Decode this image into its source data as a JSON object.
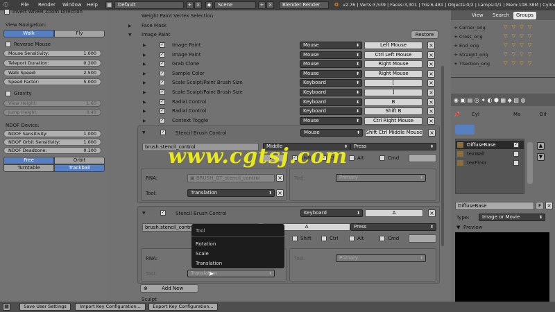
{
  "topbar": {
    "menus": [
      "File",
      "Render",
      "Window",
      "Help"
    ],
    "layout": "Default",
    "scene": "Scene",
    "engine": "Blender Render",
    "stats": "v2.76 | Verts:3,539 | Faces:3,301 | Tris:6,481 | Objects:0/2 | Lamps:0/1 | Mem:108.38M | Cyline"
  },
  "left": {
    "invert_wheel": "Invert Wheel Zoom Direction",
    "nav_title": "View Navigation:",
    "walk": "Walk",
    "fly": "Fly",
    "reverse_mouse": "Reverse Mouse",
    "fields": [
      {
        "label": "Mouse Sensitivity:",
        "value": "1.000"
      },
      {
        "label": "Teleport Duration:",
        "value": "0.200"
      },
      {
        "label": "Walk Speed:",
        "value": "2.500"
      },
      {
        "label": "Speed Factor:",
        "value": "5.000"
      }
    ],
    "gravity": "Gravity",
    "disabled_fields": [
      {
        "label": "View Height:",
        "value": "1.60"
      },
      {
        "label": "Jump Height:",
        "value": "0.40"
      }
    ],
    "ndof_title": "NDOF Device:",
    "ndof_fields": [
      {
        "label": "NDOF Sensitivity:",
        "value": "1.000"
      },
      {
        "label": "NDOF Orbit Sensitivity:",
        "value": "1.000"
      },
      {
        "label": "NDOF Deadzone:",
        "value": "0.100"
      }
    ],
    "free": "Free",
    "orbit": "Orbit",
    "turntable": "Turntable",
    "trackball": "Trackball"
  },
  "main": {
    "section1": "Weight Paint Vertex Selection",
    "section2": "Face Mask",
    "section3": "Image Paint",
    "restore": "Restore",
    "keymap_rows": [
      {
        "name": "Image Paint",
        "type": "Mouse",
        "key": "Left Mouse"
      },
      {
        "name": "Image Paint",
        "type": "Mouse",
        "key": "Ctrl Left Mouse"
      },
      {
        "name": "Grab Clone",
        "type": "Mouse",
        "key": "Right Mouse"
      },
      {
        "name": "Sample Color",
        "type": "Mouse",
        "key": "Right Mouse"
      },
      {
        "name": "Scale Sculpt/Paint Brush Size",
        "type": "Keyboard",
        "key": "["
      },
      {
        "name": "Scale Sculpt/Paint Brush Size",
        "type": "Keyboard",
        "key": "]"
      },
      {
        "name": "Radial Control",
        "type": "Keyboard",
        "key": "B"
      },
      {
        "name": "Radial Control",
        "type": "Keyboard",
        "key": "Shift B"
      },
      {
        "name": "Context Toggle",
        "type": "Mouse",
        "key": "Ctrl Right Mouse"
      }
    ],
    "exp1": {
      "name": "Stencil Brush Control",
      "type": "Mouse",
      "key": "Shift Ctrl Middle Mouse",
      "idname": "brush.stencil_control",
      "button": "Middle",
      "event": "Press",
      "any": "Any",
      "shift": "Shift",
      "ctrl": "Ctrl",
      "alt": "Alt",
      "cmd": "Cmd",
      "rna_label": "RNA:",
      "rna_value": "BRUSH_OT_stencil_control",
      "tool_label": "Tool:",
      "tool_value": "Translation",
      "tool2_label": "Tool:",
      "tool2_value": "Primary"
    },
    "exp2": {
      "name": "Stencil Brush Control",
      "type": "Keyboard",
      "key": "A",
      "idname": "brush.stencil_control",
      "button": "A",
      "event": "Press",
      "shift": "Shift",
      "ctrl": "Ctrl",
      "alt": "Alt",
      "cmd": "Cmd",
      "rna_label": "RNA:",
      "tool_label": "Tool:",
      "tool_value": "Translation",
      "tool2_label": "Tool:",
      "tool2_value": "Primary"
    },
    "add_new": "Add New",
    "sculpt": "Sculpt"
  },
  "popup": {
    "title": "Tool",
    "items": [
      "Rotation",
      "Scale",
      "Translation"
    ]
  },
  "watermark": "www.cgtsj.com",
  "right": {
    "tabs": [
      "View",
      "Search",
      "Groups"
    ],
    "outliner": [
      "Corner_orig",
      "Cross_orig",
      "End_orig",
      "Straight_orig",
      "TSection_orig"
    ],
    "breadcrumb": [
      "Cyl",
      "Ma",
      "Dif"
    ],
    "textures": [
      "DiffuseBase",
      "texWall",
      "texFloor"
    ],
    "tex_name": "DiffuseBase",
    "tex_f": "F",
    "type_label": "Type:",
    "type_value": "Image or Movie",
    "preview": "Preview"
  },
  "bottombar": {
    "save": "Save User Settings",
    "import": "Import Key Configuration...",
    "export": "Export Key Configuration..."
  }
}
